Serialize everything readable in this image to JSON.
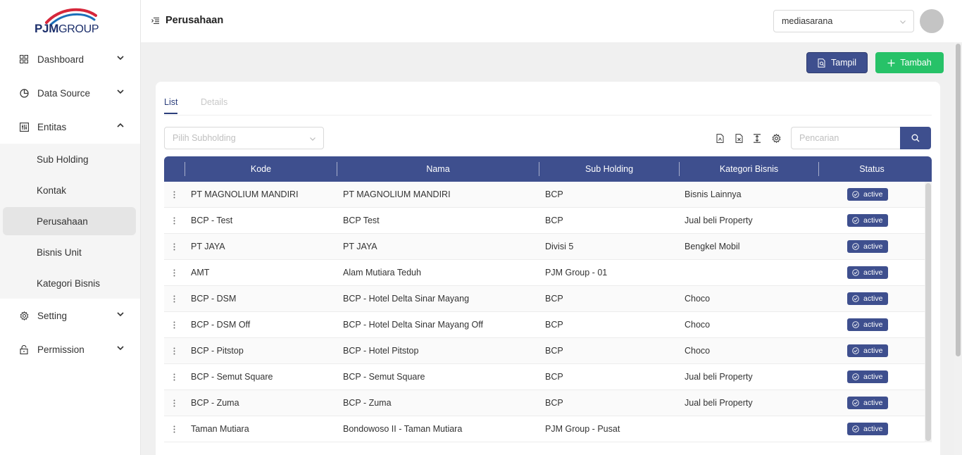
{
  "brand": {
    "logo_main": "PJM",
    "logo_sub": "GROUP"
  },
  "sidebar": {
    "items": [
      {
        "label": "Dashboard",
        "icon": "grid-icon"
      },
      {
        "label": "Data Source",
        "icon": "pie-chart-icon"
      },
      {
        "label": "Entitas",
        "icon": "sliders-icon"
      },
      {
        "label": "Setting",
        "icon": "gear-icon"
      },
      {
        "label": "Permission",
        "icon": "lock-icon"
      }
    ],
    "entitas_sub": [
      {
        "label": "Sub Holding"
      },
      {
        "label": "Kontak"
      },
      {
        "label": "Perusahaan"
      },
      {
        "label": "Bisnis Unit"
      },
      {
        "label": "Kategori Bisnis"
      }
    ]
  },
  "header": {
    "title": "Perusahaan",
    "company_selected": "mediasarana"
  },
  "actions": {
    "tampil_label": "Tampil",
    "tambah_label": "Tambah"
  },
  "tabs": {
    "list": "List",
    "details": "Details"
  },
  "filters": {
    "subholding_placeholder": "Pilih Subholding",
    "search_placeholder": "Pencarian"
  },
  "table": {
    "headers": {
      "kode": "Kode",
      "nama": "Nama",
      "sub_holding": "Sub Holding",
      "kategori": "Kategori Bisnis",
      "status": "Status"
    },
    "rows": [
      {
        "kode": "PT MAGNOLIUM MANDIRI",
        "nama": "PT MAGNOLIUM MANDIRI",
        "sub_holding": "BCP",
        "kategori": "Bisnis Lainnya",
        "status": "active"
      },
      {
        "kode": "BCP - Test",
        "nama": "BCP Test",
        "sub_holding": "BCP",
        "kategori": "Jual beli Property",
        "status": "active"
      },
      {
        "kode": "PT JAYA",
        "nama": "PT JAYA",
        "sub_holding": "Divisi 5",
        "kategori": "Bengkel Mobil",
        "status": "active"
      },
      {
        "kode": "AMT",
        "nama": "Alam Mutiara Teduh",
        "sub_holding": "PJM Group - 01",
        "kategori": "",
        "status": "active"
      },
      {
        "kode": "BCP - DSM",
        "nama": "BCP - Hotel Delta Sinar Mayang",
        "sub_holding": "BCP",
        "kategori": "Choco",
        "status": "active"
      },
      {
        "kode": "BCP - DSM Off",
        "nama": "BCP - Hotel Delta Sinar Mayang Off",
        "sub_holding": "BCP",
        "kategori": "Choco",
        "status": "active"
      },
      {
        "kode": "BCP - Pitstop",
        "nama": "BCP - Hotel Pitstop",
        "sub_holding": "BCP",
        "kategori": "Choco",
        "status": "active"
      },
      {
        "kode": "BCP - Semut Square",
        "nama": "BCP - Semut Square",
        "sub_holding": "BCP",
        "kategori": "Jual beli Property",
        "status": "active"
      },
      {
        "kode": "BCP - Zuma",
        "nama": "BCP - Zuma",
        "sub_holding": "BCP",
        "kategori": "Jual beli Property",
        "status": "active"
      },
      {
        "kode": "Taman Mutiara",
        "nama": "Bondowoso II - Taman Mutiara",
        "sub_holding": "PJM Group - Pusat",
        "kategori": "",
        "status": "active"
      }
    ]
  },
  "colors": {
    "primary": "#3e4f8e",
    "success": "#27c268",
    "logo_red": "#d6273b",
    "logo_blue": "#1c2f6b"
  }
}
